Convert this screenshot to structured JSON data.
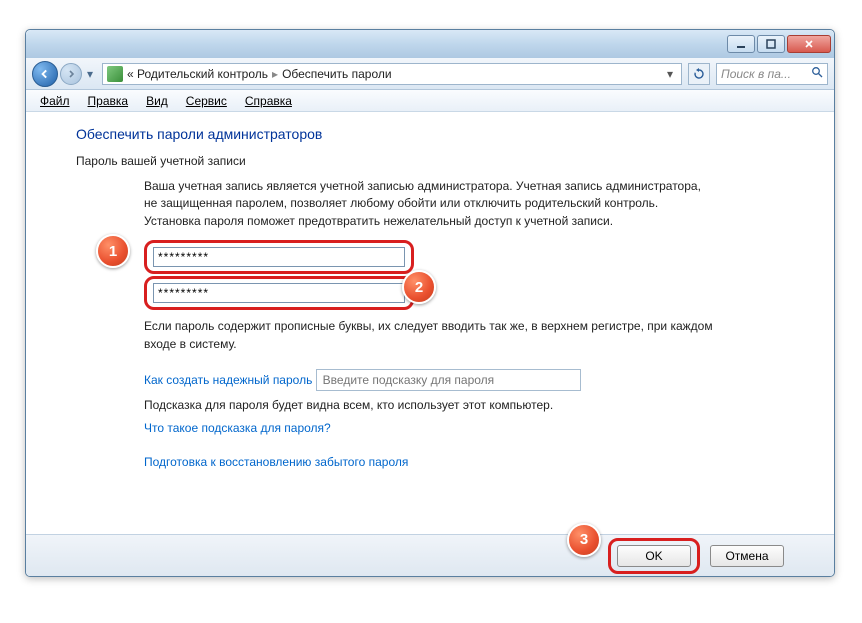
{
  "titlebar": {
    "min_tooltip": "Свернуть",
    "max_tooltip": "Развернуть",
    "close_tooltip": "Закрыть"
  },
  "nav": {
    "breadcrumb_prefix": "«",
    "breadcrumb_parent": "Родительский контроль",
    "breadcrumb_current": "Обеспечить пароли",
    "search_placeholder": "Поиск в па..."
  },
  "menu": {
    "file": "Файл",
    "edit": "Правка",
    "view": "Вид",
    "tools": "Сервис",
    "help": "Справка"
  },
  "page": {
    "title": "Обеспечить пароли администраторов",
    "section_label": "Пароль вашей учетной записи",
    "desc": "Ваша учетная запись является учетной записью администратора.  Учетная запись администратора, не защищенная паролем, позволяет любому обойти или отключить родительский контроль. Установка пароля поможет предотвратить нежелательный доступ к учетной записи.",
    "password1_value": "*********",
    "password2_value": "*********",
    "case_note": "Если пароль содержит прописные буквы, их следует вводить так же, в верхнем регистре, при каждом входе в систему.",
    "link_strong_pw": "Как создать надежный пароль",
    "hint_placeholder": "Введите подсказку для пароля",
    "hint_note": "Подсказка для пароля будет видна всем, кто использует этот компьютер.",
    "link_hint_help": "Что такое подсказка для пароля?",
    "link_recovery": "Подготовка к восстановлению забытого пароля"
  },
  "footer": {
    "ok": "OK",
    "cancel": "Отмена"
  },
  "annotations": {
    "n1": "1",
    "n2": "2",
    "n3": "3"
  }
}
